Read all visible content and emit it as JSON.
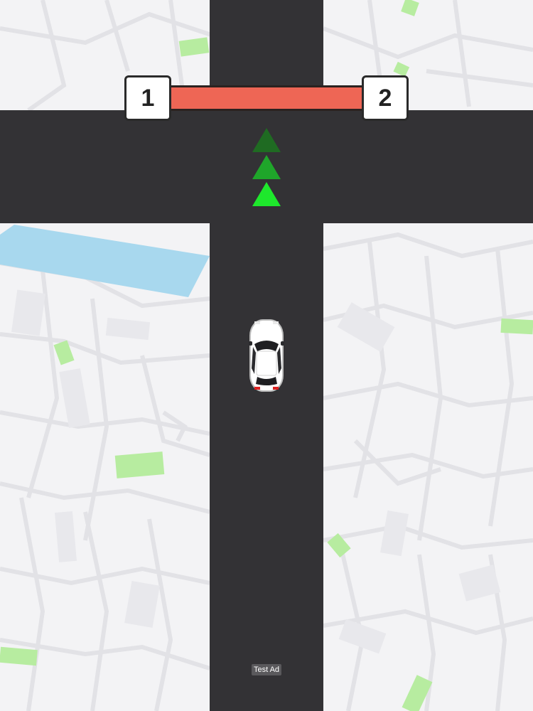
{
  "map": {
    "background_color": "#f3f3f5",
    "road_color": "#333235",
    "park_color": "#b7eca0",
    "water_color": "#a8d8ee"
  },
  "barrier": {
    "color": "#ee6655",
    "left_marker": "1",
    "right_marker": "2"
  },
  "direction_arrows": {
    "icon": "up-triangle",
    "colors": [
      "#1f6b22",
      "#1fa62a",
      "#1ee82c"
    ]
  },
  "player_car": {
    "icon": "white-car",
    "color": "#ffffff"
  },
  "ad": {
    "label": "Test Ad"
  }
}
